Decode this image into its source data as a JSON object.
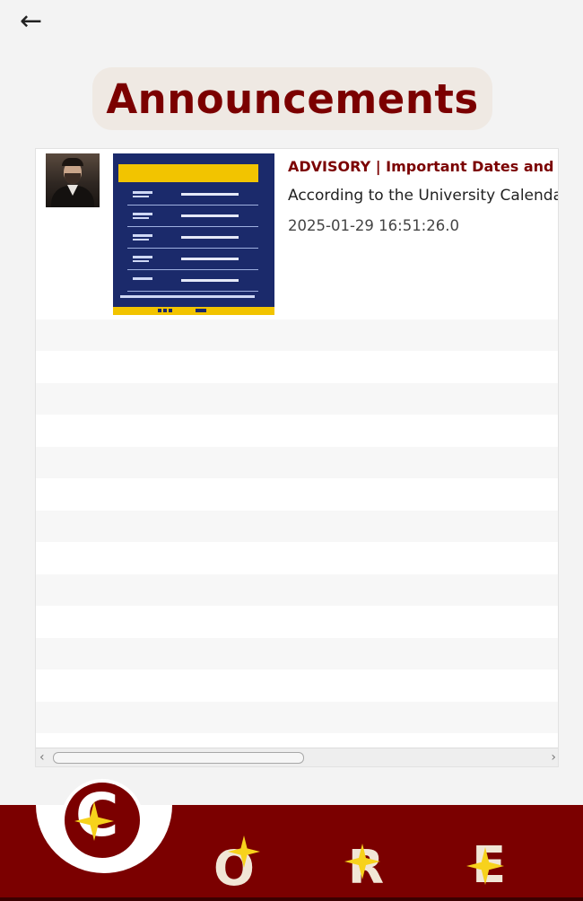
{
  "header": {
    "back_label": "←",
    "title": "Announcements"
  },
  "announcements": [
    {
      "title": "ADVISORY | Important Dates and Sch",
      "snippet": "According to the University Calendar, l",
      "date": "2025-01-29 16:51:26.0",
      "thumbnail_icon": "registration-schedule-poster"
    }
  ],
  "bottom_nav": {
    "items": [
      {
        "letter": "C",
        "icon": "sparkle-icon",
        "active": true
      },
      {
        "letter": "O",
        "icon": "sparkle-icon",
        "active": false
      },
      {
        "letter": "R",
        "icon": "sparkle-icon",
        "active": false
      },
      {
        "letter": "E",
        "icon": "sparkle-icon",
        "active": false
      }
    ]
  },
  "colors": {
    "brand": "#7b0000",
    "pill_bg": "#efe9e3",
    "sparkle": "#f7d21c",
    "poster_blue": "#1b2a6b",
    "poster_gold": "#f2c400"
  }
}
